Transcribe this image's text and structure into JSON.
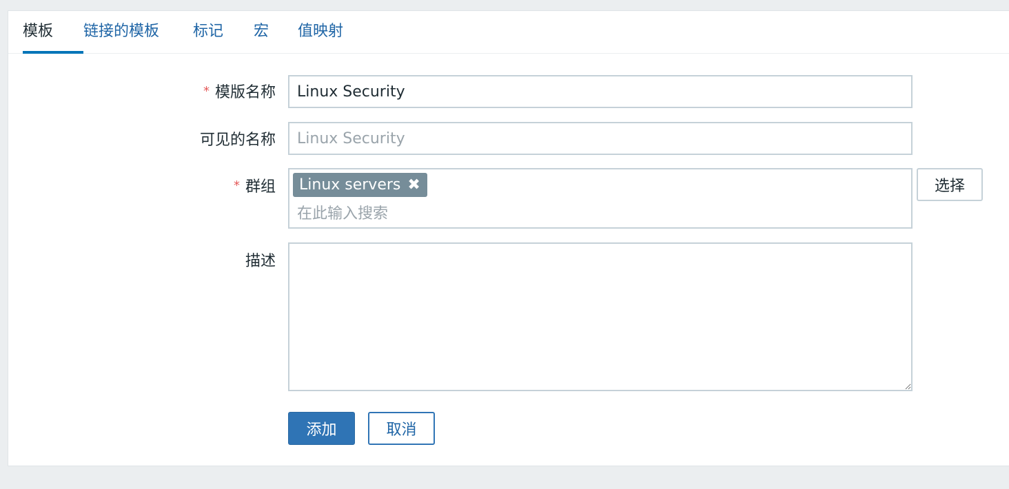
{
  "tabs": [
    {
      "label": "模板",
      "active": true
    },
    {
      "label": "链接的模板",
      "active": false
    },
    {
      "label": "标记",
      "active": false
    },
    {
      "label": "宏",
      "active": false
    },
    {
      "label": "值映射",
      "active": false
    }
  ],
  "form": {
    "required_marker": "*",
    "template_name": {
      "label": "模版名称",
      "value": "Linux Security"
    },
    "visible_name": {
      "label": "可见的名称",
      "value": "",
      "placeholder": "Linux Security"
    },
    "groups": {
      "label": "群组",
      "chips": [
        {
          "label": "Linux servers",
          "remove_icon": "✖"
        }
      ],
      "search_placeholder": "在此输入搜索",
      "select_button": "选择"
    },
    "description": {
      "label": "描述",
      "value": ""
    }
  },
  "actions": {
    "add_label": "添加",
    "cancel_label": "取消"
  },
  "colors": {
    "accent": "#0275b8",
    "link": "#1f65a6",
    "primary_button": "#2f74b5",
    "chip": "#768d99",
    "required": "#e45959",
    "page_bg": "#ebeef0"
  }
}
